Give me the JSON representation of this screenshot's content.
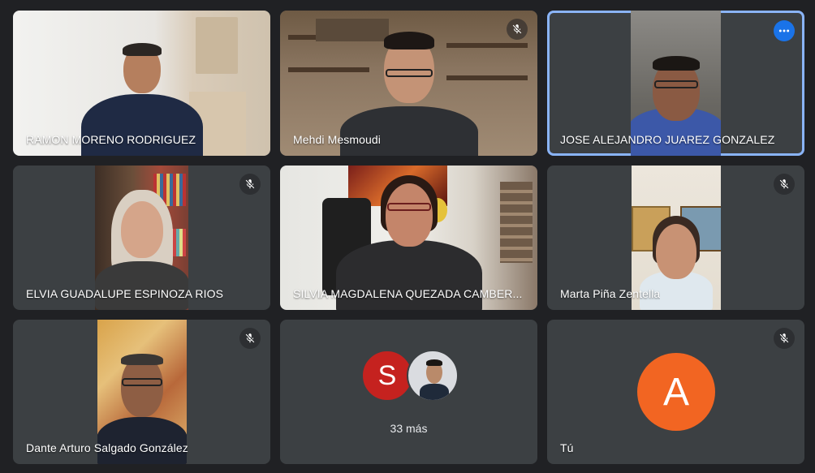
{
  "participants": [
    {
      "name": "RAMON MORENO RODRIGUEZ",
      "muted": false
    },
    {
      "name": "Mehdi Mesmoudi",
      "muted": true
    },
    {
      "name": "JOSE ALEJANDRO JUAREZ GONZALEZ",
      "muted": false,
      "active_speaker": true
    },
    {
      "name": "ELVIA GUADALUPE ESPINOZA RIOS",
      "muted": true
    },
    {
      "name": "SILVIA MAGDALENA QUEZADA CAMBER...",
      "muted": false
    },
    {
      "name": "Marta Piña Zentella",
      "muted": true
    },
    {
      "name": "Dante Arturo Salgado González",
      "muted": true
    }
  ],
  "overflow": {
    "initial": "S",
    "initial_color": "#c5221f",
    "count_label": "33 más"
  },
  "self": {
    "label": "Tú",
    "initial": "A",
    "avatar_color": "#f26522",
    "muted": true
  },
  "colors": {
    "background": "#202124",
    "tile": "#3c4043",
    "active_border": "#8ab4f8",
    "more_button": "#1a73e8"
  },
  "icons": {
    "muted": "mic-off-icon",
    "more": "more-options-icon"
  }
}
